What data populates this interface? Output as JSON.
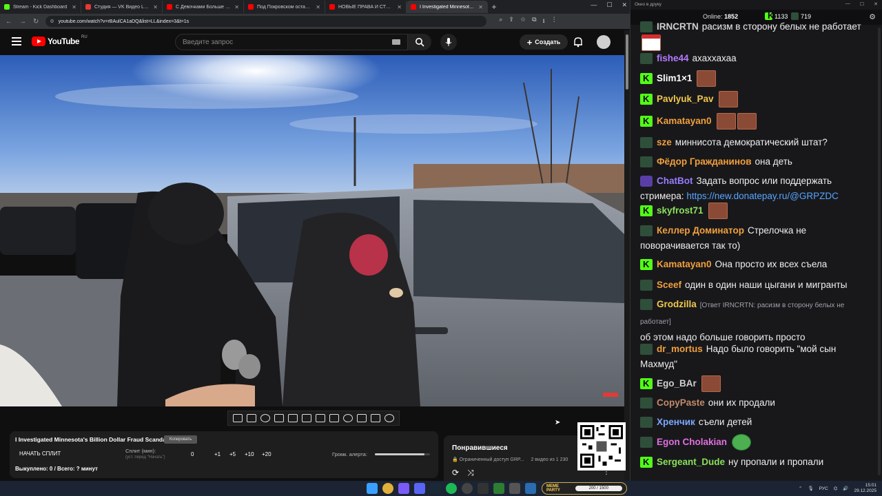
{
  "browser": {
    "tabs": [
      {
        "title": "Stream - Kick Dashboard",
        "color": "#53fc18"
      },
      {
        "title": "Студия — VK Видео Live",
        "color": "#e53935"
      },
      {
        "title": "С Девочками Больше Не Хочу",
        "color": "#ff0000"
      },
      {
        "title": "Под Покровском остановлен",
        "color": "#ff0000"
      },
      {
        "title": "НОВЫЕ ПРАВА И СТС 2026г. и",
        "color": "#ff0000"
      },
      {
        "title": "I Investigated Minnesota's B",
        "color": "#ff0000"
      }
    ],
    "url": "youtube.com/watch?v=rBAulCA1aDQ&list=LL&index=3&t=1s"
  },
  "youtube": {
    "logo_text": "YouTube",
    "region": "RU",
    "search_placeholder": "Введите запрос",
    "create_label": "Создать"
  },
  "video_info": {
    "title": "I Investigated Minnesota's Billion Dollar Fraud Scandal",
    "copy_button": "Копировать",
    "start_split": "НАЧАТЬ СПЛИТ",
    "split_label": "Сплит (мин):",
    "split_hint": "(уст. перед \"Начать\")",
    "split_value": "0",
    "add_buttons": [
      "+1",
      "+5",
      "+10",
      "+20"
    ],
    "alert_volume_label": "Громк. алерта:",
    "alert_volume": 0.9,
    "bought": "Выкуплено: 0 / Всего: ? минут"
  },
  "liked": {
    "title": "Понравившиеся",
    "subtitle": "Ограниченный доступ  GRP...",
    "count": "2 видео из 1 230"
  },
  "chat": {
    "window_title": "Окно в друку",
    "online_label": "Online:",
    "online_count": "1852",
    "kick_count": "1133",
    "vk_count": "719",
    "messages": [
      {
        "nick": "IRNCRTN",
        "color": "#cfcfcf",
        "badge": "vk",
        "text": "расизм в сторону белых не работает",
        "emotes": [
          "santa"
        ]
      },
      {
        "nick": "fishe44",
        "color": "#b57cff",
        "badge": "vk",
        "text": "ахаххахаа",
        "emotes": []
      },
      {
        "nick": "Slim1×1",
        "color": "#ffffff",
        "badge": "kick",
        "text": "",
        "emotes": [
          "face"
        ]
      },
      {
        "nick": "Pavlyuk_Pav",
        "color": "#f2c94c",
        "badge": "kick",
        "text": "",
        "emotes": [
          "face"
        ]
      },
      {
        "nick": "Kamatayan0",
        "color": "#f2a03c",
        "badge": "kick",
        "text": "",
        "emotes": [
          "face",
          "face"
        ]
      },
      {
        "nick": "sze",
        "color": "#f2a03c",
        "badge": "vk",
        "text": "миннисота демократический штат?",
        "emotes": []
      },
      {
        "nick": "Фёдор Гражданинов",
        "color": "#f2a03c",
        "badge": "vk",
        "text": "она деть",
        "emotes": []
      },
      {
        "nick": "ChatBot",
        "color": "#9a7cff",
        "badge": "bot",
        "text": "Задать вопрос или поддержать стримера:",
        "link": "https://new.donatepay.ru/@GRPZDC",
        "emotes": []
      },
      {
        "nick": "skyfrost71",
        "color": "#8be05a",
        "badge": "kick",
        "text": "",
        "emotes": [
          "face"
        ]
      },
      {
        "nick": "Келлер Доминатор",
        "color": "#f2a03c",
        "badge": "vk",
        "text": "Стрелочка не поворачивается так то)",
        "emotes": []
      },
      {
        "nick": "Kamatayan0",
        "color": "#f2a03c",
        "badge": "kick",
        "text": "Она просто их всех съела",
        "emotes": []
      },
      {
        "nick": "Sceef",
        "color": "#f2a03c",
        "badge": "vk",
        "text": "один в один наши цыгани и мигранты",
        "emotes": []
      },
      {
        "nick": "Grodzilla",
        "color": "#f2c94c",
        "badge": "vk",
        "reply": "[Ответ IRNCRTN: расизм в сторону белых не работает]",
        "text": "об этом надо больше говорить просто",
        "emotes": []
      },
      {
        "nick": "dr_mortus",
        "color": "#f2a03c",
        "badge": "vk",
        "text": "Надо было говорить \"мой сын Махмуд\"",
        "emotes": []
      },
      {
        "nick": "Ego_BAr",
        "color": "#cfcfcf",
        "badge": "kick",
        "text": "",
        "emotes": [
          "face"
        ]
      },
      {
        "nick": "CopyPaste",
        "color": "#c48a6a",
        "badge": "vk",
        "text": "они их продали",
        "emotes": []
      },
      {
        "nick": "Хренчик",
        "color": "#7ca8ff",
        "badge": "vk",
        "text": "съели детей",
        "emotes": []
      },
      {
        "nick": "Egon Cholakian",
        "color": "#e070e0",
        "badge": "vk",
        "text": "",
        "emotes": [
          "frog"
        ]
      },
      {
        "nick": "Sergeant_Dude",
        "color": "#8be05a",
        "badge": "kick",
        "text": "ну пропали и пропали",
        "emotes": []
      }
    ]
  },
  "taskbar": {
    "meme_label": "MEME PARTY",
    "meme_progress": "200 / 1500",
    "lang": "РУС",
    "time": "15:01",
    "date": "29.12.2025"
  }
}
